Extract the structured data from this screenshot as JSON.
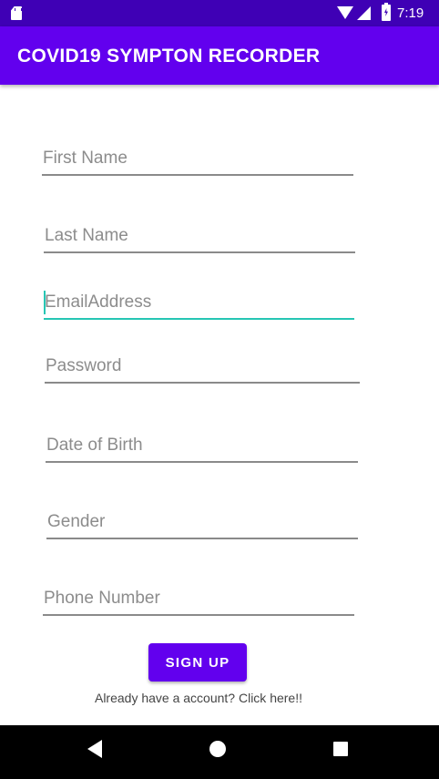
{
  "status_bar": {
    "time": "7:19",
    "icons": [
      "sd-card-icon",
      "wifi-icon",
      "signal-icon",
      "battery-charging-icon"
    ]
  },
  "app_bar": {
    "title": "COVID19 SYMPTON RECORDER"
  },
  "form": {
    "first_name": "First Name",
    "last_name": "Last Name",
    "email": "EmailAddress",
    "password": "Password",
    "dob": "Date of Birth",
    "gender": "Gender",
    "phone": "Phone Number"
  },
  "actions": {
    "signup_label": "SIGN UP",
    "login_link": "Already have a account? Click here!!"
  },
  "colors": {
    "primary": "#6200ee",
    "primary_dark": "#3f00b5",
    "accent": "#26c6b4"
  },
  "nav_bar": {
    "icons": [
      "back-icon",
      "home-icon",
      "recents-icon"
    ]
  }
}
